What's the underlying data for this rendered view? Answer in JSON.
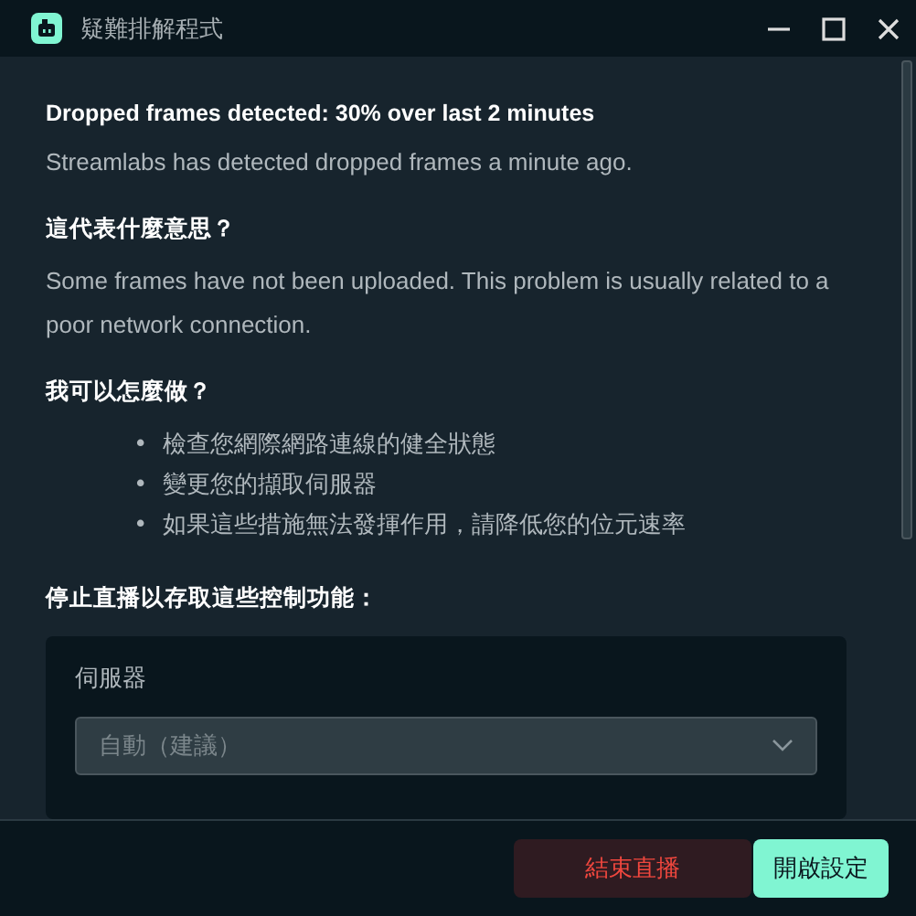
{
  "window": {
    "title": "疑難排解程式"
  },
  "alert": {
    "heading": "Dropped frames detected: 30% over last 2 minutes",
    "text": "Streamlabs has detected dropped frames a minute ago."
  },
  "sections": [
    {
      "heading": "這代表什麼意思？",
      "text": "Some frames have not been uploaded. This problem is usually related to a poor network connection."
    },
    {
      "heading": "我可以怎麼做？",
      "bullets": [
        {
          "marker": "•",
          "text": "檢查您網際網路連線的健全狀態"
        },
        {
          "marker": "•",
          "text": "變更您的擷取伺服器"
        },
        {
          "marker": "•",
          "text": "如果這些措施無法發揮作用，請降低您的位元速率"
        }
      ]
    }
  ],
  "controls": {
    "heading": "停止直播以存取這些控制功能：",
    "field_label": "伺服器",
    "select": {
      "value": "自動（建議）",
      "disabled": true
    }
  },
  "buttons": [
    {
      "label": "結束直播",
      "kind": "danger"
    },
    {
      "label": "開啟設定",
      "kind": "primary"
    }
  ]
}
